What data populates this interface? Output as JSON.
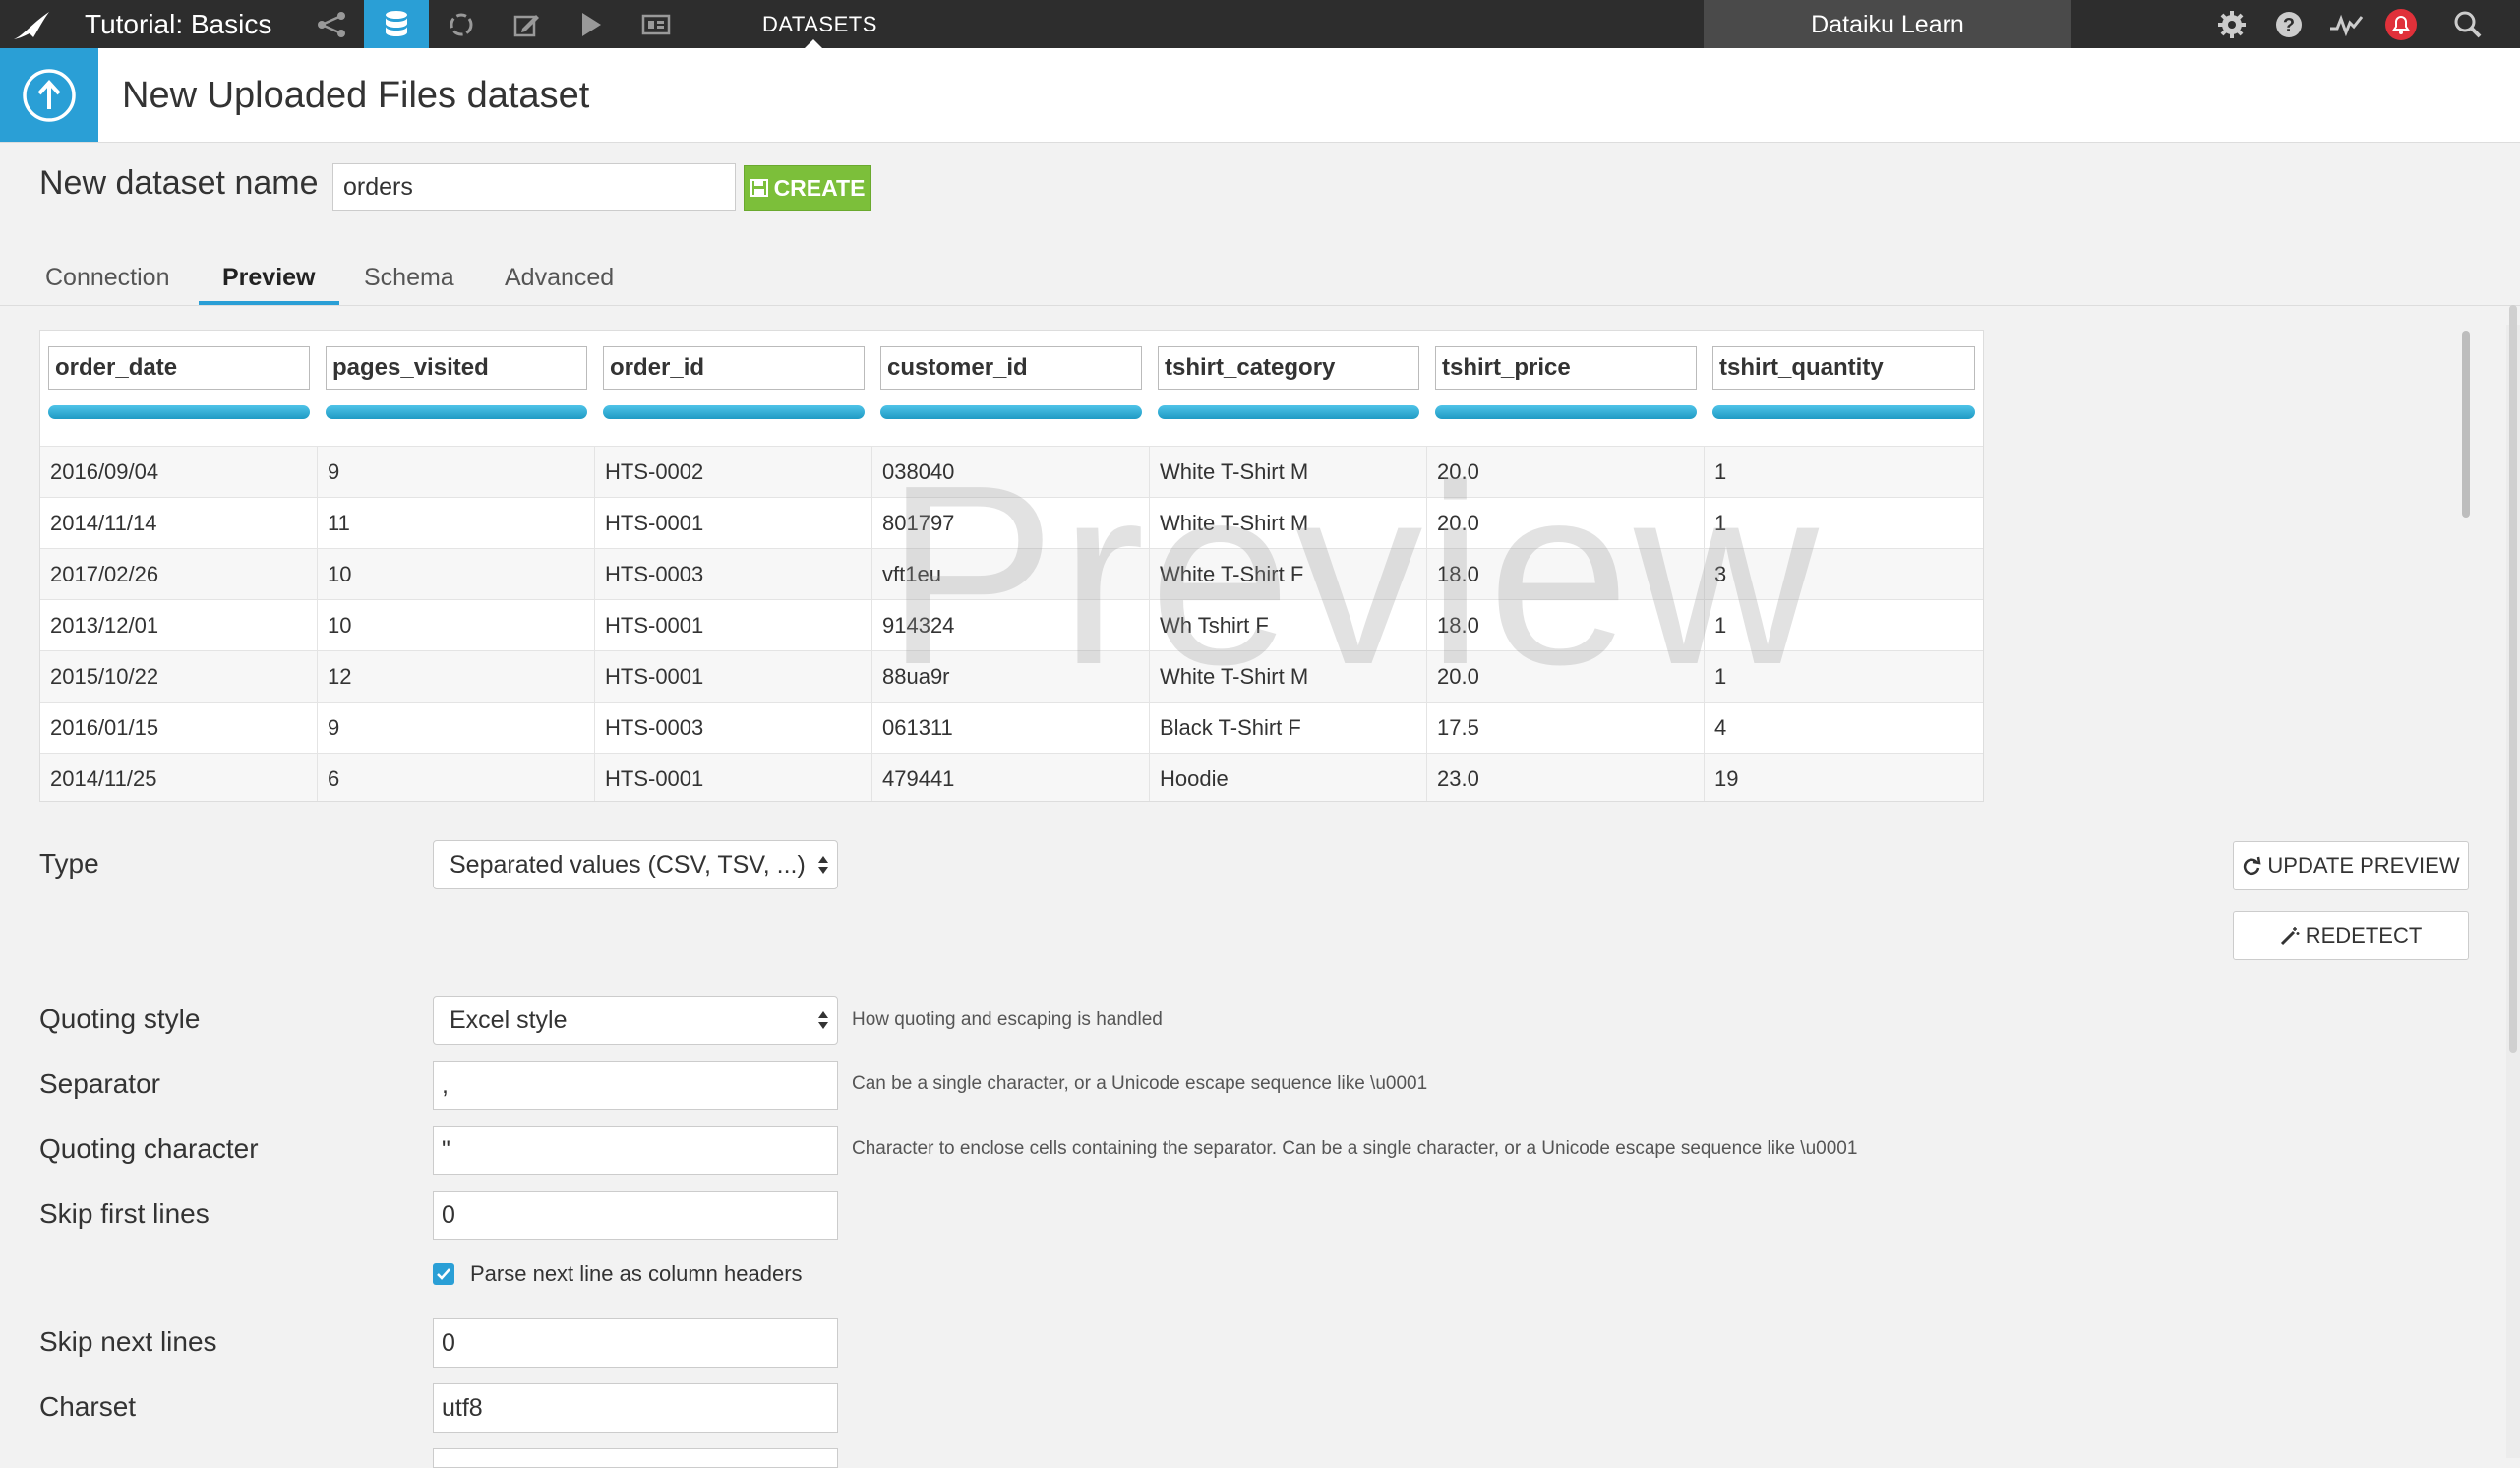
{
  "topbar": {
    "project": "Tutorial: Basics",
    "section": "DATASETS",
    "instance": "Dataiku Learn",
    "colors": {
      "bar": "#2d2d2d",
      "active": "#2a9fd6",
      "alert": "#e0313a"
    }
  },
  "header": {
    "title": "New Uploaded Files dataset"
  },
  "name_row": {
    "label": "New dataset name",
    "value": "orders",
    "create_label": "CREATE",
    "create_color": "#7cbf3a"
  },
  "tabs": [
    {
      "label": "Connection"
    },
    {
      "label": "Preview"
    },
    {
      "label": "Schema"
    },
    {
      "label": "Advanced"
    }
  ],
  "table": {
    "watermark": "Preview",
    "columns": [
      "order_date",
      "pages_visited",
      "order_id",
      "customer_id",
      "tshirt_category",
      "tshirt_price",
      "tshirt_quantity"
    ],
    "rows": [
      [
        "2016/09/04",
        "9",
        "HTS-0002",
        "038040",
        "White T-Shirt M",
        "20.0",
        "1"
      ],
      [
        "2014/11/14",
        "11",
        "HTS-0001",
        "801797",
        "White T-Shirt M",
        "20.0",
        "1"
      ],
      [
        "2017/02/26",
        "10",
        "HTS-0003",
        "vft1eu",
        "White T-Shirt F",
        "18.0",
        "3"
      ],
      [
        "2013/12/01",
        "10",
        "HTS-0001",
        "914324",
        "Wh Tshirt F",
        "18.0",
        "1"
      ],
      [
        "2015/10/22",
        "12",
        "HTS-0001",
        "88ua9r",
        "White T-Shirt M",
        "20.0",
        "1"
      ],
      [
        "2016/01/15",
        "9",
        "HTS-0003",
        "061311",
        "Black T-Shirt F",
        "17.5",
        "4"
      ],
      [
        "2014/11/25",
        "6",
        "HTS-0001",
        "479441",
        "Hoodie",
        "23.0",
        "19"
      ]
    ]
  },
  "form": {
    "type_label": "Type",
    "type_value": "Separated values (CSV, TSV, ...)",
    "update_preview_label": "UPDATE PREVIEW",
    "redetect_label": "REDETECT",
    "quoting_style_label": "Quoting style",
    "quoting_style_value": "Excel style",
    "quoting_style_help": "How quoting and escaping is handled",
    "separator_label": "Separator",
    "separator_value": ",",
    "separator_help": "Can be a single character, or a Unicode escape sequence like \\u0001",
    "quoting_char_label": "Quoting character",
    "quoting_char_value": "\"",
    "quoting_char_help": "Character to enclose cells containing the separator. Can be a single character, or a Unicode escape sequence like \\u0001",
    "skip_first_label": "Skip first lines",
    "skip_first_value": "0",
    "parse_header_label": "Parse next line as column headers",
    "skip_next_label": "Skip next lines",
    "skip_next_value": "0",
    "charset_label": "Charset",
    "charset_value": "utf8"
  }
}
